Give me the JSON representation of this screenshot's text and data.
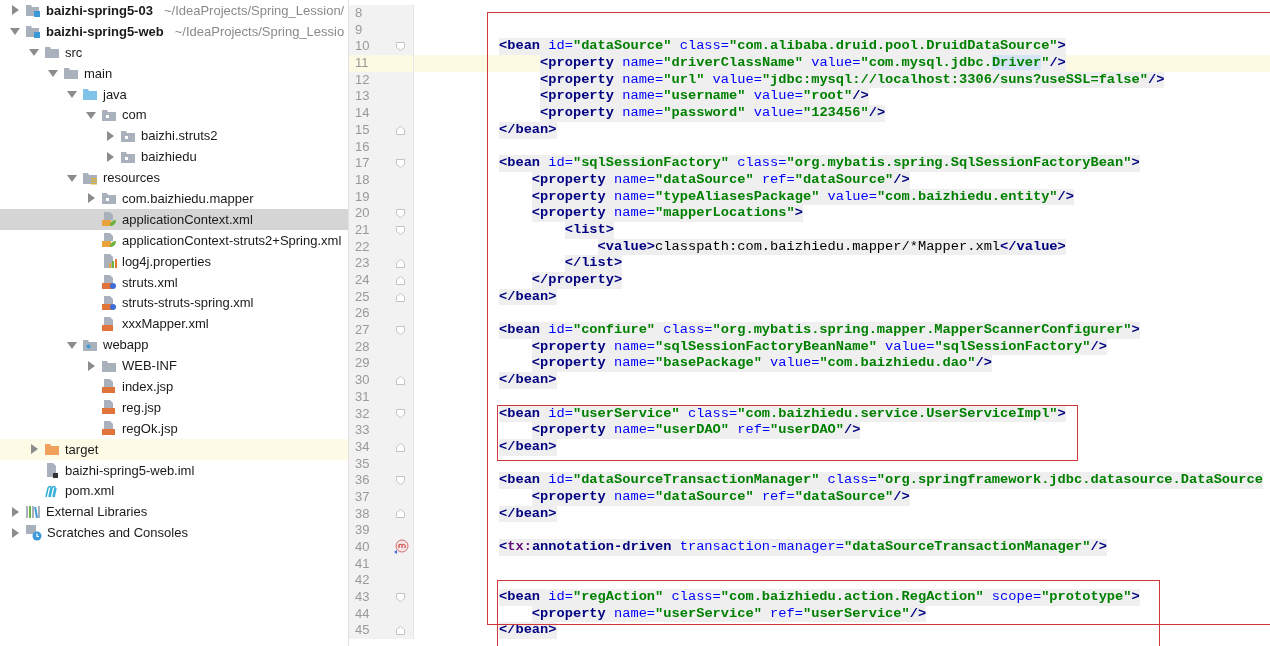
{
  "project_tree": [
    {
      "label": "baizhi-spring5-03",
      "path": "~/IdeaProjects/Spring_Lession/",
      "kind": "module",
      "expanded": false,
      "selected": false,
      "highlighted": false
    },
    {
      "label": "baizhi-spring5-web",
      "path": "~/IdeaProjects/Spring_Lessio",
      "kind": "module",
      "expanded": true,
      "selected": false,
      "highlighted": false,
      "children": [
        {
          "label": "src",
          "kind": "folder",
          "expanded": true,
          "selected": false,
          "highlighted": false,
          "children": [
            {
              "label": "main",
              "kind": "folder",
              "expanded": true,
              "selected": false,
              "highlighted": false,
              "children": [
                {
                  "label": "java",
                  "kind": "source",
                  "expanded": true,
                  "selected": false,
                  "highlighted": false,
                  "children": [
                    {
                      "label": "com",
                      "kind": "package",
                      "expanded": true,
                      "selected": false,
                      "highlighted": false,
                      "children": [
                        {
                          "label": "baizhi.struts2",
                          "kind": "package",
                          "expanded": false,
                          "selected": false,
                          "highlighted": false
                        },
                        {
                          "label": "baizhiedu",
                          "kind": "package",
                          "expanded": false,
                          "selected": false,
                          "highlighted": false
                        }
                      ]
                    }
                  ]
                },
                {
                  "label": "resources",
                  "kind": "resources",
                  "expanded": true,
                  "selected": false,
                  "highlighted": false,
                  "children": [
                    {
                      "label": "com.baizhiedu.mapper",
                      "kind": "package",
                      "expanded": false,
                      "selected": false,
                      "highlighted": false
                    },
                    {
                      "label": "applicationContext.xml",
                      "kind": "spring",
                      "selected": true,
                      "highlighted": false
                    },
                    {
                      "label": "applicationContext-struts2+Spring.xml",
                      "kind": "spring",
                      "selected": false,
                      "highlighted": false
                    },
                    {
                      "label": "log4j.properties",
                      "kind": "properties",
                      "selected": false,
                      "highlighted": false
                    },
                    {
                      "label": "struts.xml",
                      "kind": "struts",
                      "selected": false,
                      "highlighted": false
                    },
                    {
                      "label": "struts-struts-spring.xml",
                      "kind": "struts",
                      "selected": false,
                      "highlighted": false
                    },
                    {
                      "label": "xxxMapper.xml",
                      "kind": "xml",
                      "selected": false,
                      "highlighted": false
                    }
                  ]
                },
                {
                  "label": "webapp",
                  "kind": "web",
                  "expanded": true,
                  "selected": false,
                  "highlighted": false,
                  "children": [
                    {
                      "label": "WEB-INF",
                      "kind": "folder",
                      "expanded": false,
                      "selected": false,
                      "highlighted": false
                    },
                    {
                      "label": "index.jsp",
                      "kind": "jsp",
                      "selected": false,
                      "highlighted": false
                    },
                    {
                      "label": "reg.jsp",
                      "kind": "jsp",
                      "selected": false,
                      "highlighted": false
                    },
                    {
                      "label": "regOk.jsp",
                      "kind": "jsp",
                      "selected": false,
                      "highlighted": false
                    }
                  ]
                }
              ]
            }
          ]
        },
        {
          "label": "target",
          "kind": "excluded",
          "expanded": false,
          "selected": false,
          "highlighted": true
        },
        {
          "label": "baizhi-spring5-web.iml",
          "kind": "iml",
          "selected": false,
          "highlighted": false
        },
        {
          "label": "pom.xml",
          "kind": "maven",
          "selected": false,
          "highlighted": false
        }
      ]
    },
    {
      "label": "External Libraries",
      "kind": "libraries",
      "expanded": false,
      "selected": false,
      "highlighted": false
    },
    {
      "label": "Scratches and Consoles",
      "kind": "scratches",
      "expanded": false,
      "selected": false,
      "highlighted": false
    }
  ],
  "editor": {
    "lines": [
      {
        "number": "8",
        "current": false
      },
      {
        "number": "9",
        "current": false
      },
      {
        "number": "10",
        "current": false,
        "kind": "fold-start",
        "code": [
          {
            "kind": "tag",
            "text": "<bean"
          },
          {
            "kind": "attr",
            "text": " id="
          },
          {
            "kind": "value",
            "text": "\"dataSource\""
          },
          {
            "kind": "attr",
            "text": " class="
          },
          {
            "kind": "value",
            "text": "\"com.alibaba.druid.pool.DruidDataSource\""
          },
          {
            "kind": "tag",
            "text": ">"
          }
        ]
      },
      {
        "number": "11",
        "current": true,
        "code": [
          {
            "kind": "tag",
            "text": "     <property"
          },
          {
            "kind": "attr",
            "text": " name="
          },
          {
            "kind": "value",
            "text": "\"driverClassName\""
          },
          {
            "kind": "attr",
            "text": " value="
          },
          {
            "kind": "value",
            "text": "\"com.mysql.jdbc."
          },
          {
            "kind": "match",
            "text": "Driver"
          },
          {
            "kind": "value",
            "text": "\""
          },
          {
            "kind": "tag",
            "text": "/>"
          }
        ]
      },
      {
        "number": "12",
        "current": false,
        "code": [
          {
            "kind": "tag",
            "text": "     <property"
          },
          {
            "kind": "attr",
            "text": " name="
          },
          {
            "kind": "value",
            "text": "\"url\""
          },
          {
            "kind": "attr",
            "text": " value="
          },
          {
            "kind": "value",
            "text": "\"jdbc:mysql://localhost:3306/suns?useSSL=false\""
          },
          {
            "kind": "tag",
            "text": "/>"
          }
        ]
      },
      {
        "number": "13",
        "current": false,
        "code": [
          {
            "kind": "tag",
            "text": "     <property"
          },
          {
            "kind": "attr",
            "text": " name="
          },
          {
            "kind": "value",
            "text": "\"username\""
          },
          {
            "kind": "attr",
            "text": " value="
          },
          {
            "kind": "value",
            "text": "\"root\""
          },
          {
            "kind": "tag",
            "text": "/>"
          }
        ]
      },
      {
        "number": "14",
        "current": false,
        "code": [
          {
            "kind": "tag",
            "text": "     <property"
          },
          {
            "kind": "attr",
            "text": " name="
          },
          {
            "kind": "value",
            "text": "\"password\""
          },
          {
            "kind": "attr",
            "text": " value="
          },
          {
            "kind": "value",
            "text": "\"123456\""
          },
          {
            "kind": "tag",
            "text": "/>"
          }
        ]
      },
      {
        "number": "15",
        "current": false,
        "kind": "fold-end",
        "code": [
          {
            "kind": "tag",
            "text": "</bean>"
          }
        ]
      },
      {
        "number": "16",
        "current": false
      },
      {
        "number": "17",
        "current": false,
        "kind": "fold-start",
        "code": [
          {
            "kind": "tag",
            "text": "<bean"
          },
          {
            "kind": "attr",
            "text": " id="
          },
          {
            "kind": "value",
            "text": "\"sqlSessionFactory\""
          },
          {
            "kind": "attr",
            "text": " class="
          },
          {
            "kind": "value",
            "text": "\"org.mybatis.spring.SqlSessionFactoryBean\""
          },
          {
            "kind": "tag",
            "text": ">"
          }
        ]
      },
      {
        "number": "18",
        "current": false,
        "code": [
          {
            "kind": "tag",
            "text": "    <property"
          },
          {
            "kind": "attr",
            "text": " name="
          },
          {
            "kind": "value",
            "text": "\"dataSource\""
          },
          {
            "kind": "attr",
            "text": " ref="
          },
          {
            "kind": "value",
            "text": "\"dataSource\""
          },
          {
            "kind": "tag",
            "text": "/>"
          }
        ]
      },
      {
        "number": "19",
        "current": false,
        "code": [
          {
            "kind": "tag",
            "text": "    <property"
          },
          {
            "kind": "attr",
            "text": " name="
          },
          {
            "kind": "value",
            "text": "\"typeAliasesPackage\""
          },
          {
            "kind": "attr",
            "text": " value="
          },
          {
            "kind": "value",
            "text": "\"com.baizhiedu.entity\""
          },
          {
            "kind": "tag",
            "text": "/>"
          }
        ]
      },
      {
        "number": "20",
        "current": false,
        "kind": "fold-start",
        "code": [
          {
            "kind": "tag",
            "text": "    <property"
          },
          {
            "kind": "attr",
            "text": " name="
          },
          {
            "kind": "value",
            "text": "\"mapperLocations\""
          },
          {
            "kind": "tag",
            "text": ">"
          }
        ]
      },
      {
        "number": "21",
        "current": false,
        "kind": "fold-start",
        "code": [
          {
            "kind": "tag",
            "text": "        <list>"
          }
        ]
      },
      {
        "number": "22",
        "current": false,
        "code": [
          {
            "kind": "tag",
            "text": "            <value>"
          },
          {
            "kind": "text",
            "text": "classpath:com.baizhiedu.mapper/*Mapper.xml"
          },
          {
            "kind": "tag",
            "text": "</value>"
          }
        ]
      },
      {
        "number": "23",
        "current": false,
        "kind": "fold-end",
        "code": [
          {
            "kind": "tag",
            "text": "        </list>"
          }
        ]
      },
      {
        "number": "24",
        "current": false,
        "kind": "fold-end",
        "code": [
          {
            "kind": "tag",
            "text": "    </property>"
          }
        ]
      },
      {
        "number": "25",
        "current": false,
        "kind": "fold-end",
        "code": [
          {
            "kind": "tag",
            "text": "</bean>"
          }
        ]
      },
      {
        "number": "26",
        "current": false
      },
      {
        "number": "27",
        "current": false,
        "kind": "fold-start",
        "code": [
          {
            "kind": "tag",
            "text": "<bean"
          },
          {
            "kind": "attr",
            "text": " id="
          },
          {
            "kind": "value",
            "text": "\"confiure\""
          },
          {
            "kind": "attr",
            "text": " class="
          },
          {
            "kind": "value",
            "text": "\"org.mybatis.spring.mapper.MapperScannerConfigurer\""
          },
          {
            "kind": "tag",
            "text": ">"
          }
        ]
      },
      {
        "number": "28",
        "current": false,
        "code": [
          {
            "kind": "tag",
            "text": "    <property"
          },
          {
            "kind": "attr",
            "text": " name="
          },
          {
            "kind": "value",
            "text": "\"sqlSessionFactoryBeanName\""
          },
          {
            "kind": "attr",
            "text": " value="
          },
          {
            "kind": "value",
            "text": "\"sqlSessionFactory\""
          },
          {
            "kind": "tag",
            "text": "/>"
          }
        ]
      },
      {
        "number": "29",
        "current": false,
        "code": [
          {
            "kind": "tag",
            "text": "    <property"
          },
          {
            "kind": "attr",
            "text": " name="
          },
          {
            "kind": "value",
            "text": "\"basePackage\""
          },
          {
            "kind": "attr",
            "text": " value="
          },
          {
            "kind": "value",
            "text": "\"com.baizhiedu.dao\""
          },
          {
            "kind": "tag",
            "text": "/>"
          }
        ]
      },
      {
        "number": "30",
        "current": false,
        "kind": "fold-end",
        "code": [
          {
            "kind": "tag",
            "text": "</bean>"
          }
        ]
      },
      {
        "number": "31",
        "current": false
      },
      {
        "number": "32",
        "current": false,
        "kind": "fold-start",
        "code": [
          {
            "kind": "tag",
            "text": "<bean"
          },
          {
            "kind": "attr",
            "text": " id="
          },
          {
            "kind": "value",
            "text": "\"userService\""
          },
          {
            "kind": "attr",
            "text": " class="
          },
          {
            "kind": "value",
            "text": "\"com.baizhiedu.service.UserServiceImpl\""
          },
          {
            "kind": "tag",
            "text": ">"
          }
        ]
      },
      {
        "number": "33",
        "current": false,
        "code": [
          {
            "kind": "tag",
            "text": "    <property"
          },
          {
            "kind": "attr",
            "text": " name="
          },
          {
            "kind": "value",
            "text": "\"userDAO\""
          },
          {
            "kind": "attr",
            "text": " ref="
          },
          {
            "kind": "value",
            "text": "\"userDAO\""
          },
          {
            "kind": "tag",
            "text": "/>"
          }
        ]
      },
      {
        "number": "34",
        "current": false,
        "kind": "fold-end",
        "code": [
          {
            "kind": "tag",
            "text": "</bean>"
          }
        ]
      },
      {
        "number": "35",
        "current": false
      },
      {
        "number": "36",
        "current": false,
        "kind": "fold-start",
        "code": [
          {
            "kind": "tag",
            "text": "<bean"
          },
          {
            "kind": "attr",
            "text": " id="
          },
          {
            "kind": "value",
            "text": "\"dataSourceTransactionManager\""
          },
          {
            "kind": "attr",
            "text": " class="
          },
          {
            "kind": "value",
            "text": "\"org.springframework.jdbc.datasource.DataSource"
          }
        ]
      },
      {
        "number": "37",
        "current": false,
        "code": [
          {
            "kind": "tag",
            "text": "    <property"
          },
          {
            "kind": "attr",
            "text": " name="
          },
          {
            "kind": "value",
            "text": "\"dataSource\""
          },
          {
            "kind": "attr",
            "text": " ref="
          },
          {
            "kind": "value",
            "text": "\"dataSource\""
          },
          {
            "kind": "tag",
            "text": "/>"
          }
        ]
      },
      {
        "number": "38",
        "current": false,
        "kind": "fold-end",
        "code": [
          {
            "kind": "tag",
            "text": "</bean>"
          }
        ]
      },
      {
        "number": "39",
        "current": false
      },
      {
        "number": "40",
        "current": false,
        "kind": "marker",
        "code": [
          {
            "kind": "tag",
            "text": "<"
          },
          {
            "kind": "namespace",
            "text": "tx:"
          },
          {
            "kind": "tag",
            "text": "annotation-driven"
          },
          {
            "kind": "attr",
            "text": " transaction-manager="
          },
          {
            "kind": "value",
            "text": "\"dataSourceTransactionManager\""
          },
          {
            "kind": "tag",
            "text": "/>"
          }
        ]
      },
      {
        "number": "41",
        "current": false
      },
      {
        "number": "42",
        "current": false
      },
      {
        "number": "43",
        "current": false,
        "kind": "fold-start",
        "code": [
          {
            "kind": "tag",
            "text": "<bean"
          },
          {
            "kind": "attr",
            "text": " id="
          },
          {
            "kind": "value",
            "text": "\"regAction\""
          },
          {
            "kind": "attr",
            "text": " class="
          },
          {
            "kind": "value",
            "text": "\"com.baizhiedu.action.RegAction\""
          },
          {
            "kind": "attr",
            "text": " scope="
          },
          {
            "kind": "value",
            "text": "\"prototype\""
          },
          {
            "kind": "tag",
            "text": ">"
          }
        ]
      },
      {
        "number": "44",
        "current": false,
        "code": [
          {
            "kind": "tag",
            "text": "    <property"
          },
          {
            "kind": "attr",
            "text": " name="
          },
          {
            "kind": "value",
            "text": "\"userService\""
          },
          {
            "kind": "attr",
            "text": " ref="
          },
          {
            "kind": "value",
            "text": "\"userService\""
          },
          {
            "kind": "tag",
            "text": "/>"
          }
        ]
      },
      {
        "number": "45",
        "current": false,
        "kind": "fold-end",
        "code": [
          {
            "kind": "tag",
            "text": "</bean>"
          }
        ]
      }
    ]
  }
}
